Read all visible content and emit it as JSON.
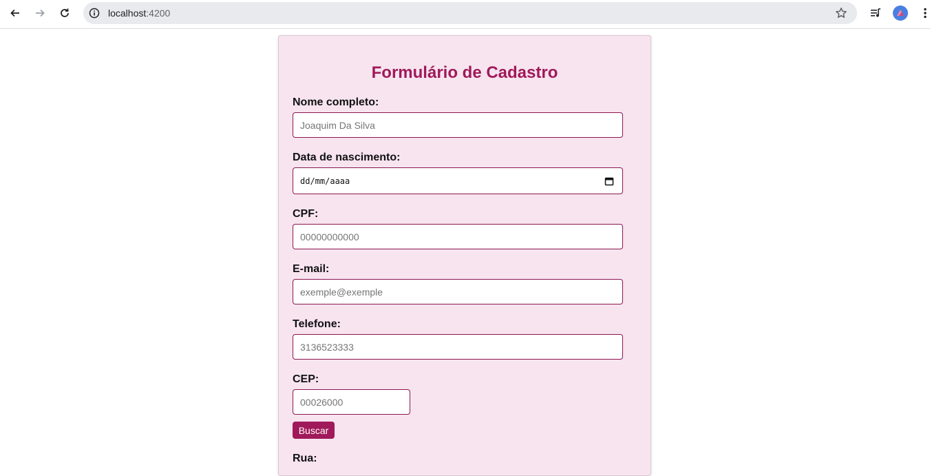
{
  "browser": {
    "url_host": "localhost",
    "url_port": ":4200"
  },
  "form": {
    "title": "Formulário de Cadastro",
    "fields": [
      {
        "label": "Nome completo:",
        "placeholder": "Joaquim Da Silva"
      },
      {
        "label": "Data de nascimento:",
        "placeholder": "dd/mm/aaaa"
      },
      {
        "label": "CPF:",
        "placeholder": "00000000000"
      },
      {
        "label": "E-mail:",
        "placeholder": "exemple@exemple"
      },
      {
        "label": "Telefone:",
        "placeholder": "3136523333"
      },
      {
        "label": "CEP:",
        "placeholder": "00026000"
      },
      {
        "label": "Rua:"
      }
    ],
    "search_button": "Buscar"
  },
  "colors": {
    "accent": "#a0195a",
    "card_bg": "#f7e4ef",
    "input_border": "#8a1550"
  }
}
